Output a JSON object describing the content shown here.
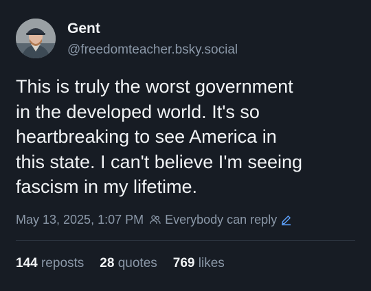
{
  "post": {
    "author": {
      "name": "Gent",
      "handle": "@freedomteacher.bsky.social",
      "avatar_icon": "user-avatar"
    },
    "text_lines": [
      "This is truly the worst government",
      "in the developed world. It's so",
      "heartbreaking to see America in",
      "this state. I can't believe I'm seeing",
      "fascism in my lifetime."
    ],
    "timestamp": "May 13, 2025, 1:07 PM",
    "reply_setting": {
      "label": "Everybody can reply",
      "icon": "people-icon",
      "edit_icon": "pencil-icon"
    },
    "stats": {
      "reposts": {
        "count": "144",
        "label": "reposts"
      },
      "quotes": {
        "count": "28",
        "label": "quotes"
      },
      "likes": {
        "count": "769",
        "label": "likes"
      }
    }
  },
  "colors": {
    "background": "#171c24",
    "text_primary": "#f1f3f5",
    "text_secondary": "#8b98a8",
    "accent": "#5b9df5",
    "divider": "#2b333e"
  }
}
